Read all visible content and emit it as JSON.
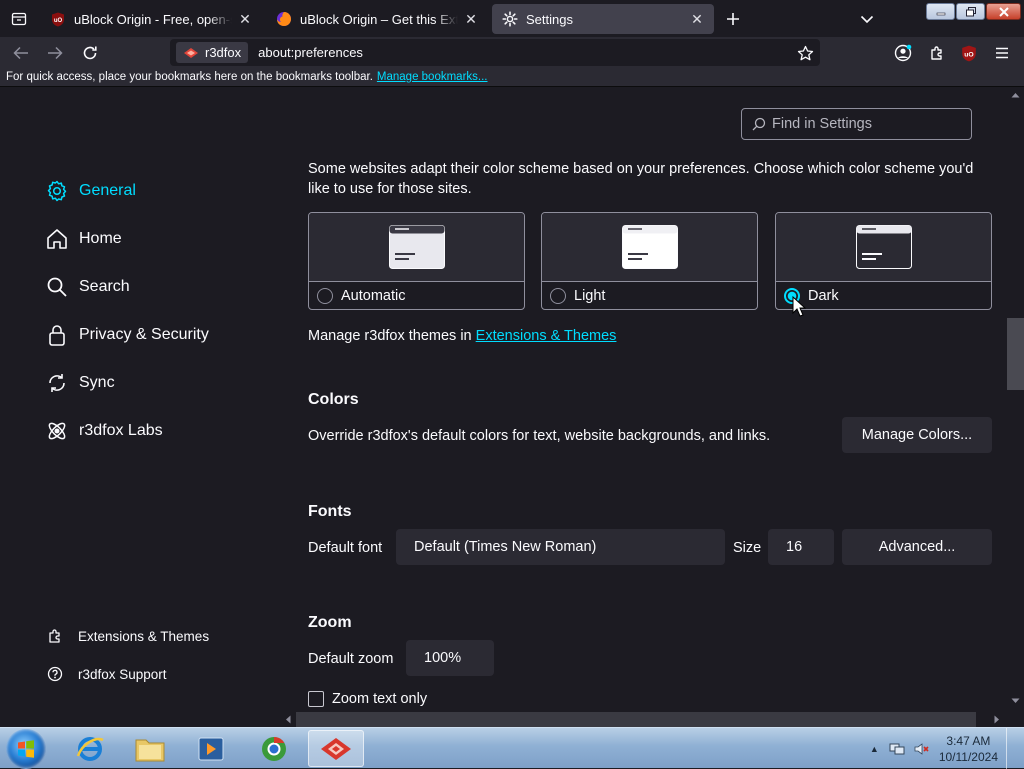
{
  "tabs": [
    {
      "title": "uBlock Origin - Free, open-sour",
      "favicon": "ublock-icon",
      "selected": false
    },
    {
      "title": "uBlock Origin – Get this Extensio",
      "favicon": "firefox-icon",
      "selected": false
    },
    {
      "title": "Settings",
      "favicon": "gear-icon",
      "selected": true
    }
  ],
  "navbar": {
    "identity_label": "r3dfox",
    "url": "about:preferences"
  },
  "bookmarks": {
    "prompt": "For quick access, place your bookmarks here on the bookmarks toolbar.",
    "manage_link": "Manage bookmarks..."
  },
  "search": {
    "placeholder": "Find in Settings"
  },
  "sidebar": {
    "items": [
      {
        "label": "General",
        "icon": "gear-icon",
        "active": true
      },
      {
        "label": "Home",
        "icon": "home-icon",
        "active": false
      },
      {
        "label": "Search",
        "icon": "search-icon",
        "active": false
      },
      {
        "label": "Privacy & Security",
        "icon": "lock-icon",
        "active": false
      },
      {
        "label": "Sync",
        "icon": "sync-icon",
        "active": false
      },
      {
        "label": "r3dfox Labs",
        "icon": "labs-icon",
        "active": false
      }
    ],
    "footer": [
      {
        "label": "Extensions & Themes",
        "icon": "puzzle-icon"
      },
      {
        "label": "r3dfox Support",
        "icon": "help-icon"
      }
    ]
  },
  "appearance": {
    "intro": "Some websites adapt their color scheme based on your preferences. Choose which color scheme you'd like to use for those sites.",
    "themes": [
      {
        "label": "Automatic",
        "checked": false
      },
      {
        "label": "Light",
        "checked": false
      },
      {
        "label": "Dark",
        "checked": true
      }
    ],
    "manage_prefix": "Manage r3dfox themes in ",
    "manage_link": "Extensions & Themes"
  },
  "colors": {
    "heading": "Colors",
    "description": "Override r3dfox's default colors for text, website backgrounds, and links.",
    "button": "Manage Colors..."
  },
  "fonts": {
    "heading": "Fonts",
    "default_label": "Default font",
    "default_value": "Default (Times New Roman)",
    "size_label": "Size",
    "size_value": "16",
    "advanced_button": "Advanced..."
  },
  "zoom": {
    "heading": "Zoom",
    "default_label": "Default zoom",
    "default_value": "100%",
    "text_only_label": "Zoom text only",
    "text_only_checked": false
  },
  "taskbar": {
    "time": "3:47 AM",
    "date": "10/11/2024"
  },
  "colors_theme": {
    "accent": "#00ddff",
    "background": "#1c1b22",
    "surface": "#2b2a33"
  }
}
